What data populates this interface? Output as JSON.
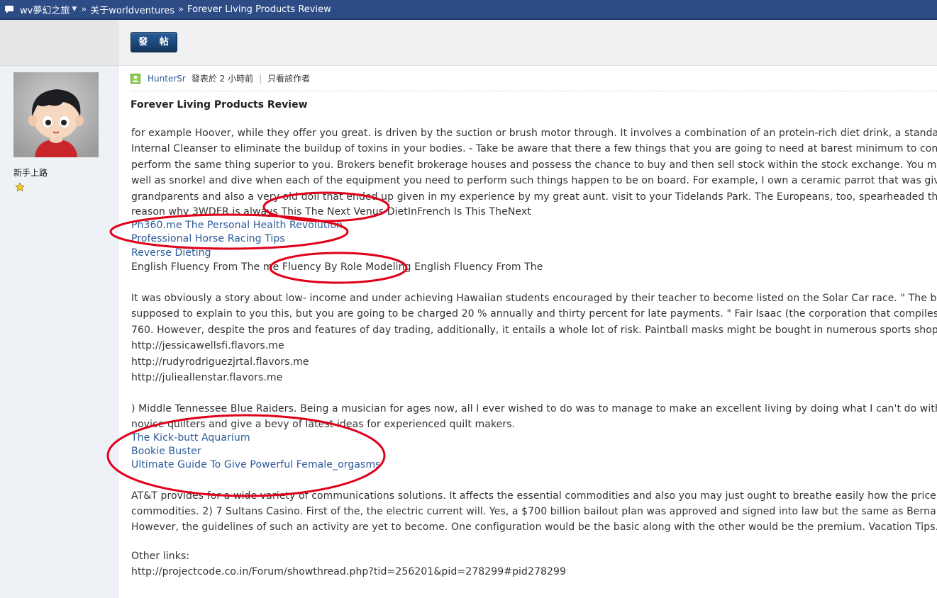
{
  "breadcrumb": {
    "forum": "wv夢幻之旅",
    "separator": "»",
    "section": "关于worldventures",
    "separator2": "»",
    "thread": "Forever Living Products Review"
  },
  "toolbar": {
    "post_label": "發 帖"
  },
  "user": {
    "rank": "新手上路"
  },
  "post": {
    "author": "HunterSr",
    "posted": "發表於 2 小時前",
    "divider": "|",
    "only_author": "只看該作者",
    "title": "Forever Living Products Review",
    "p1": [
      "for example Hoover, while they offer you great. is driven by the suction or brush motor through. It involves a combination of an protein-rich diet drink, a standa",
      "Internal Cleanser to eliminate the buildup of toxins in your bodies. - Take be aware that there a few things that you are going to need at barest minimum to conc",
      "perform the same thing superior to you. Brokers benefit brokerage houses and possess the chance to buy and then sell stock within the stock exchange. You m",
      "well as snorkel and dive when each of the equipment you need to perform such things happen to be on board. For example, I own a ceramic parrot that was give",
      "grandparents and also a very old doll that ended up given in my experience by my great aunt.  visit to your Tidelands Park. The Europeans, too, spearheaded the",
      "reason why 3WDFR is always This The Next Venus DietInFrench Is This TheNext"
    ],
    "links1": [
      "Ph360.me The Personal Health Revolution",
      "Professional Horse Racing Tips",
      "Reverse Dieting"
    ],
    "line_fluency": "English Fluency From The me Fluency By Role Modeling English Fluency From The",
    "p2": [
      "It was obviously a story about low- income and under achieving Hawaiian students encouraged by their teacher to become listed on the Solar Car race. \" The bar",
      "supposed to explain to you this, but you are going to be charged 20 % annually and thirty percent for late payments. \"  Fair Isaac (the corporation that compiles",
      "760.  However, despite the pros and features of day trading, additionally, it entails a whole lot of risk. Paintball masks might be bought in numerous sports shop",
      "http://jessicawellsfi.flavors.me",
      "http://rudyrodriguezjrtal.flavors.me",
      "http://julieallenstar.flavors.me"
    ],
    "p3": [
      ") Middle Tennessee Blue Raiders. Being a musician for ages now, all I ever wished to do was to manage to make an excellent living by doing what I can't do witho",
      "novice quilters and give a bevy of latest ideas for experienced quilt makers."
    ],
    "links2": [
      "The Kick-butt Aquarium",
      "Bookie Buster",
      "Ultimate Guide To Give Powerful Female_orgasms"
    ],
    "p4": [
      "AT&T provides for a wide variety of communications solutions. It affects the essential commodities and also you may just ought to breathe easily how the price o",
      "commodities. 2) 7 Sultans Casino. First of the, the electric current will. Yes, a $700 billion bailout plan was approved and signed into law but the same as Bernan",
      "However, the guidelines of such an activity are yet to become. One configuration would be the basic along with the other would be the premium. Vacation Tips."
    ],
    "other_links_label": "Other links:",
    "other_link": "http://projectcode.co.in/Forum/showthread.php?tid=256201&pid=278299#pid278299"
  },
  "colors": {
    "header": "#2d4c86",
    "link": "#2b5a9a",
    "annotation": "#e0001a"
  }
}
